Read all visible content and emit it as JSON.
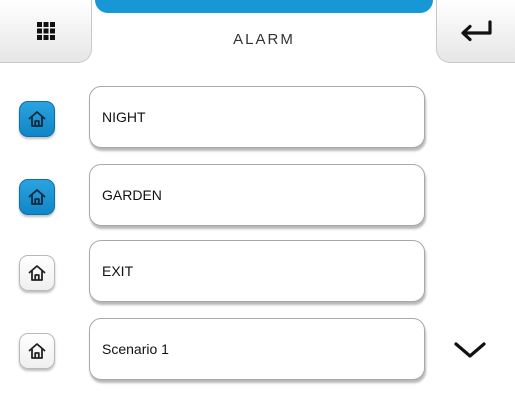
{
  "header": {
    "title": "ALARM",
    "menu_icon": "grid-icon",
    "back_icon": "return-arrow-icon"
  },
  "colors": {
    "accent": "#1797d6",
    "active_icon_bg": "#1a93d6"
  },
  "rows": [
    {
      "label": "NIGHT",
      "icon": "home-icon",
      "active": true
    },
    {
      "label": "GARDEN",
      "icon": "home-icon",
      "active": true
    },
    {
      "label": "EXIT",
      "icon": "home-icon",
      "active": false
    },
    {
      "label": "Scenario 1",
      "icon": "home-icon",
      "active": false
    }
  ],
  "scroll": {
    "icon": "chevron-down-icon"
  }
}
